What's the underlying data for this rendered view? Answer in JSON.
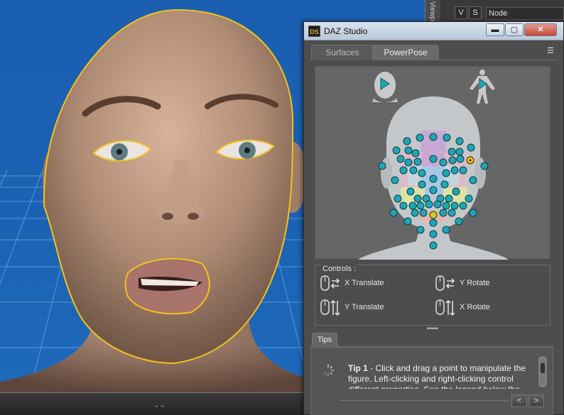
{
  "window": {
    "title": "DAZ Studio",
    "logo": "DS"
  },
  "title_buttons": {
    "minimize": "▬",
    "maximize": "▢",
    "close": "✕"
  },
  "top_pane": {
    "viewport_tab": "Viewport",
    "tab_v": "V",
    "tab_s": "S",
    "node_label": "Node"
  },
  "tabs": [
    {
      "label": "Surfaces",
      "active": false
    },
    {
      "label": "PowerPose",
      "active": true
    }
  ],
  "controls": {
    "title": "Controls :",
    "items": [
      {
        "label": "X Translate",
        "icon": "mouse-horizontal-icon"
      },
      {
        "label": "Y Rotate",
        "icon": "mouse-horizontal-icon"
      },
      {
        "label": "Y Translate",
        "icon": "mouse-vertical-icon"
      },
      {
        "label": "X Rotate",
        "icon": "mouse-vertical-icon"
      }
    ]
  },
  "tips": {
    "tab_label": "Tips",
    "tip_number": "Tip 1",
    "tip_text": " - Click and drag a point to manipulate the figure. Left-clicking and right-clicking control different properties. See the legend below the",
    "prev": "<",
    "next": ">"
  },
  "colors": {
    "accent": "#1fa6b6",
    "selected_point": "#f2c40c",
    "viewport_bg": "#1c63b4",
    "selection_outline": "#f1c21d"
  }
}
